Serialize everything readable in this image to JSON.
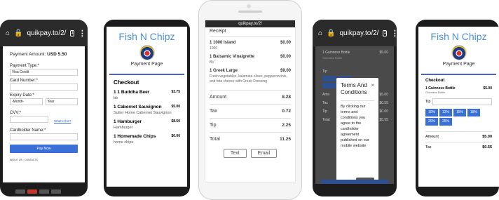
{
  "phone1": {
    "url": "quikpay.to/2/",
    "amount_label": "Payment Amount:",
    "amount_value": "USD 5.50",
    "payment_type_label": "Payment Type:*",
    "payment_type_value": "Visa Credit",
    "card_number_label": "Card Number:*",
    "expiry_label": "Expiry Date:*",
    "month_placeholder": "-Month-",
    "year_placeholder": "Year",
    "cvv_label": "CVV:*",
    "whats_this": "What's this?",
    "cardholder_label": "Cardholder Name:*",
    "pay_now": "Pay Now",
    "fine_print": "ABOUT US · CONTACTS"
  },
  "phone2": {
    "brand": "Fish N Chipz",
    "subtitle": "Payment Page",
    "checkout_title": "Checkout",
    "items": [
      {
        "name": "1 1 Buddha Beer",
        "price": "$3.75",
        "desc": "bb"
      },
      {
        "name": "1 Cabernet Sauvignon",
        "price": "$5.00",
        "desc": "Sutter Home Cabernet Sauvignon"
      },
      {
        "name": "1 Hamburger",
        "price": "$8.50",
        "desc": "Hamburger"
      },
      {
        "name": "1 Homemade Chips",
        "price": "$0.00",
        "desc": "home chips"
      }
    ]
  },
  "phone3": {
    "url": "quikpay.to/2/",
    "receipt_title": "Receipt",
    "items": [
      {
        "name": "1 1000 Island",
        "price": "$0.00",
        "desc": "1000"
      },
      {
        "name": "1 Balsamic Vinaigrette",
        "price": "$0.00",
        "desc": "BV"
      },
      {
        "name": "1 Greek Large",
        "price": "$9.00",
        "desc": "Fresh vegetables, kalamata olives, pepperoncinis, and feta cheese with Greek Dressing"
      }
    ],
    "summary": [
      {
        "label": "Amount",
        "value": "8.28"
      },
      {
        "label": "Tax",
        "value": "0.72"
      },
      {
        "label": "Tip",
        "value": "2.25"
      },
      {
        "label": "Total",
        "value": "11.25"
      }
    ],
    "text_button": "Text",
    "email_button": "Email"
  },
  "phone4": {
    "url": "quikpay.to/2/",
    "bg_item_name": "1 Guinness Bottle",
    "bg_item_price": "$5.00",
    "bg_item_desc": "Guinness Bottle",
    "bg_tip": "Tip",
    "bg_rows": [
      {
        "label": "Amo",
        "value": "$5.00"
      },
      {
        "label": "Tax",
        "value": "$0.55"
      },
      {
        "label": "Tip",
        "value": "$0.00"
      },
      {
        "label": "Total",
        "value": "$5.55"
      }
    ],
    "modal_title": "Terms And Conditions",
    "modal_close_x": "×",
    "modal_text": "By clicking our terms and conditions you agree to the cardholder agreement published on our mobile website",
    "close_button": "Close"
  },
  "phone5": {
    "brand": "Fish N Chipz",
    "subtitle": "Payment Page",
    "checkout_title": "Checkout",
    "item_name": "1 Guinness Bottle",
    "item_price": "$5.00",
    "item_desc": "Guinness Bottle",
    "tip_label": "Tip",
    "tip_options": [
      "10%",
      "12%",
      "15%",
      "18%",
      "20%",
      "25%"
    ],
    "summary": [
      {
        "label": "Amount",
        "value": "$5.00"
      },
      {
        "label": "Tax",
        "value": "$0.55"
      }
    ]
  }
}
